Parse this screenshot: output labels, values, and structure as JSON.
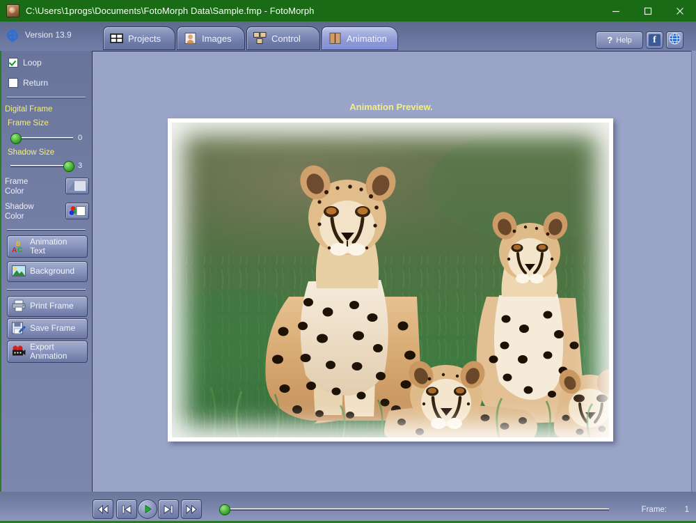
{
  "window": {
    "title": "C:\\Users\\1progs\\Documents\\FotoMorph Data\\Sample.fmp - FotoMorph",
    "icon": "app-photo-icon",
    "minimize_label": "—",
    "maximize_label": "□",
    "close_label": "✕",
    "titlebar_color": "#1a6b16"
  },
  "header": {
    "logo": "fotomorph-logo-icon",
    "version": "Version 13.9",
    "tabs": [
      {
        "label": "Projects",
        "icon": "projects-grid-icon",
        "active": false
      },
      {
        "label": "Images",
        "icon": "images-portrait-icon",
        "active": false
      },
      {
        "label": "Control",
        "icon": "control-frames-icon",
        "active": false
      },
      {
        "label": "Animation",
        "icon": "animation-split-icon",
        "active": true
      }
    ],
    "help_label": "Help",
    "help_icon": "question-mark-icon",
    "facebook_icon": "facebook-icon",
    "facebook_glyph": "f",
    "web_icon": "globe-icon"
  },
  "sidebar": {
    "checkboxes": [
      {
        "label": "Loop",
        "checked": true
      },
      {
        "label": "Return",
        "checked": false
      }
    ],
    "section_title": "Digital Frame",
    "sliders": [
      {
        "label": "Frame Size",
        "value": "0",
        "percent": 0
      },
      {
        "label": "Shadow Size",
        "value": "3",
        "percent": 100
      }
    ],
    "color_rows": [
      {
        "label_line1": "Frame",
        "label_line2": "Color",
        "swatch": "frame-color-swatch"
      },
      {
        "label_line1": "Shadow",
        "label_line2": "Color",
        "swatch": "shadow-color-swatch"
      }
    ],
    "buttons": [
      {
        "line1": "Animation",
        "line2": "Text",
        "icon": "abc-text-icon"
      },
      {
        "line1": "Background",
        "line2": "",
        "icon": "landscape-icon"
      },
      {
        "line1": "Print Frame",
        "line2": "",
        "icon": "printer-icon"
      },
      {
        "line1": "Save Frame",
        "line2": "",
        "icon": "save-disk-icon"
      },
      {
        "line1": "Export",
        "line2": "Animation",
        "icon": "film-camera-icon"
      }
    ]
  },
  "main": {
    "preview_title": "Animation Preview.",
    "preview_image_alt": "cheetah-family-photo"
  },
  "playback": {
    "buttons": [
      {
        "name": "skip-to-start-button",
        "icon": "rewind-all-icon"
      },
      {
        "name": "previous-frame-button",
        "icon": "step-back-icon"
      },
      {
        "name": "play-button",
        "icon": "play-icon"
      },
      {
        "name": "next-frame-button",
        "icon": "step-forward-icon"
      },
      {
        "name": "skip-to-end-button",
        "icon": "forward-all-icon"
      }
    ],
    "frame_slider_percent": 0,
    "frame_label": "Frame:",
    "frame_value": "1"
  },
  "colors": {
    "title_green": "#1a6b16",
    "panel_blue": "#9aa4c8",
    "accent_yellow": "#f2f07e",
    "knob_green": "#3cab2e"
  }
}
